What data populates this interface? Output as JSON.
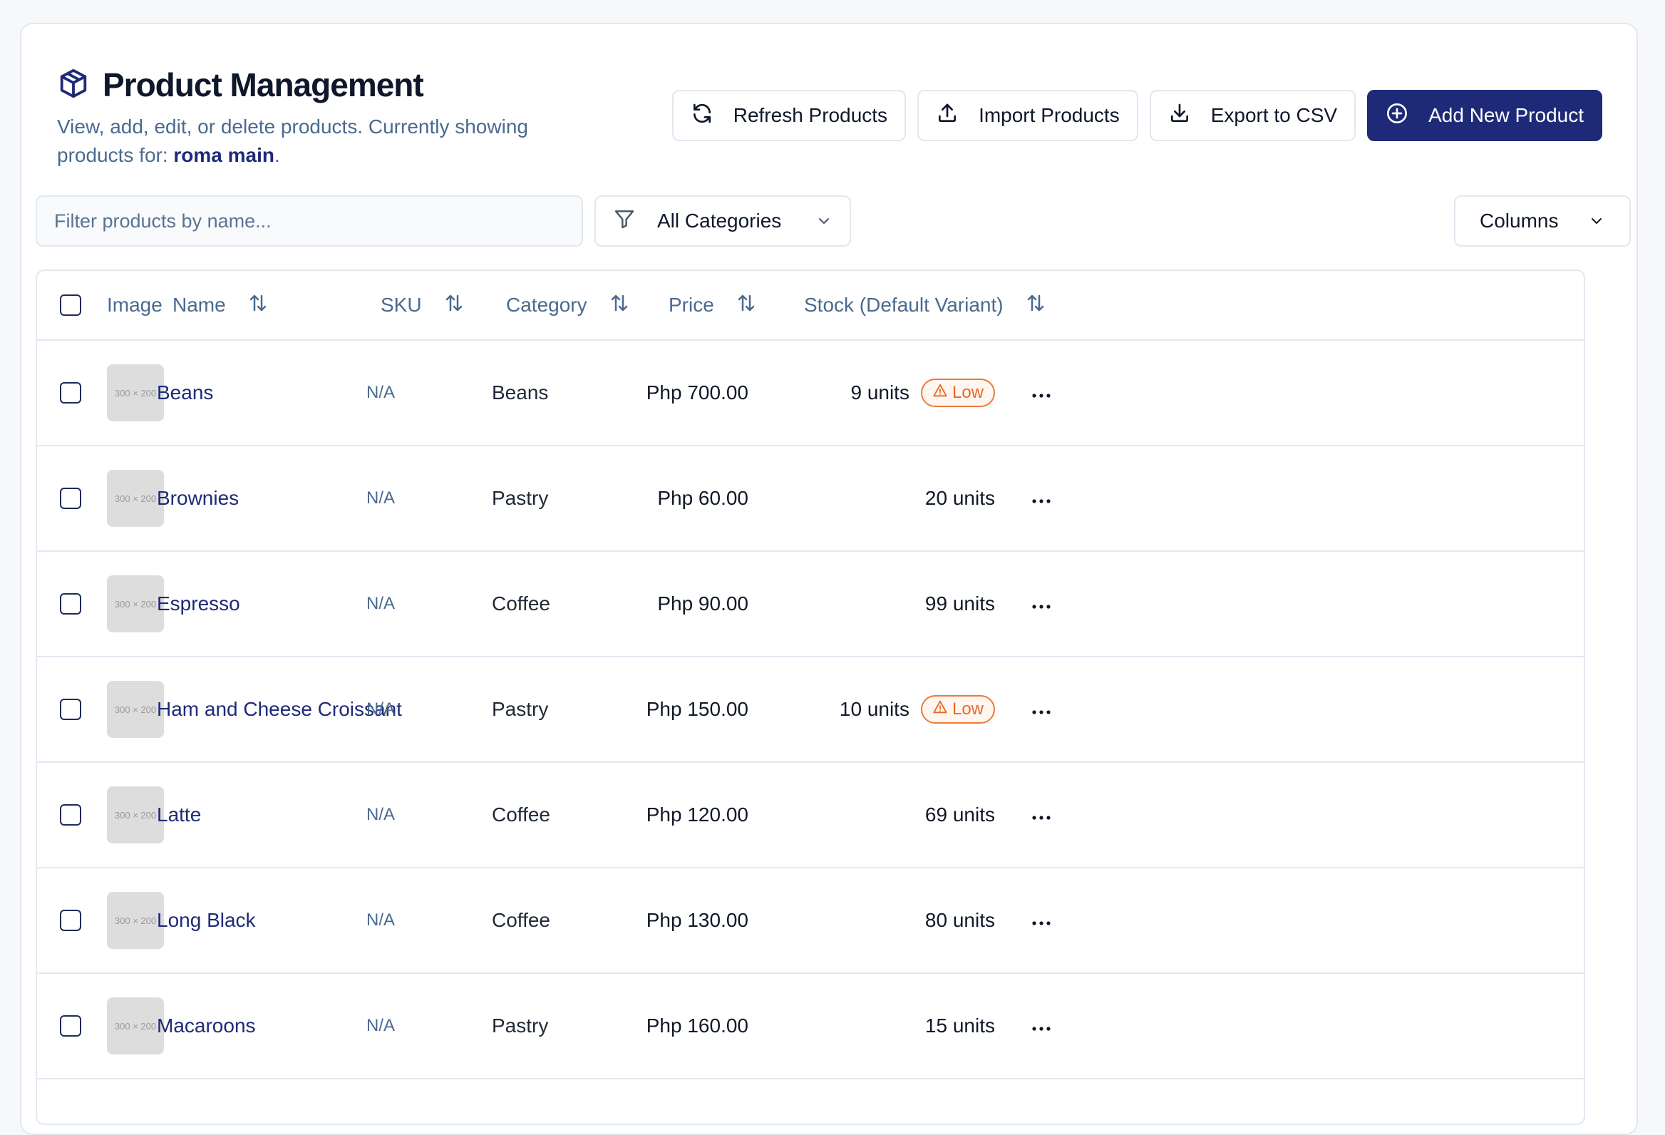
{
  "header": {
    "title": "Product Management",
    "subtitle_prefix": "View, add, edit, or delete products. Currently showing products for: ",
    "location": "roma main",
    "subtitle_suffix": ".",
    "icon": "package-icon"
  },
  "actions": {
    "refresh": {
      "label": "Refresh Products",
      "icon": "refresh-icon"
    },
    "import": {
      "label": "Import Products",
      "icon": "upload-icon"
    },
    "export": {
      "label": "Export to CSV",
      "icon": "download-icon"
    },
    "add": {
      "label": "Add New Product",
      "icon": "plus-circle-icon"
    }
  },
  "filters": {
    "search_placeholder": "Filter products by name...",
    "category_selected": "All Categories",
    "columns_label": "Columns"
  },
  "table": {
    "columns": {
      "image": "Image",
      "name": "Name",
      "sku": "SKU",
      "category": "Category",
      "price": "Price",
      "stock": "Stock (Default Variant)"
    },
    "low_label": "Low",
    "thumb_label": "300 × 200",
    "rows": [
      {
        "name": "Beans",
        "sku": "N/A",
        "category": "Beans",
        "price": "Php 700.00",
        "stock": "9 units",
        "low": true
      },
      {
        "name": "Brownies",
        "sku": "N/A",
        "category": "Pastry",
        "price": "Php 60.00",
        "stock": "20 units",
        "low": false
      },
      {
        "name": "Espresso",
        "sku": "N/A",
        "category": "Coffee",
        "price": "Php 90.00",
        "stock": "99 units",
        "low": false
      },
      {
        "name": "Ham and Cheese Croissant",
        "sku": "N/A",
        "category": "Pastry",
        "price": "Php 150.00",
        "stock": "10 units",
        "low": true
      },
      {
        "name": "Latte",
        "sku": "N/A",
        "category": "Coffee",
        "price": "Php 120.00",
        "stock": "69 units",
        "low": false
      },
      {
        "name": "Long Black",
        "sku": "N/A",
        "category": "Coffee",
        "price": "Php 130.00",
        "stock": "80 units",
        "low": false
      },
      {
        "name": "Macaroons",
        "sku": "N/A",
        "category": "Pastry",
        "price": "Php 160.00",
        "stock": "15 units",
        "low": false
      }
    ]
  },
  "colors": {
    "primary": "#1e2a78",
    "muted_text": "#4a6a8f",
    "border": "#e2e8f0",
    "low_badge": "#e8672c"
  }
}
